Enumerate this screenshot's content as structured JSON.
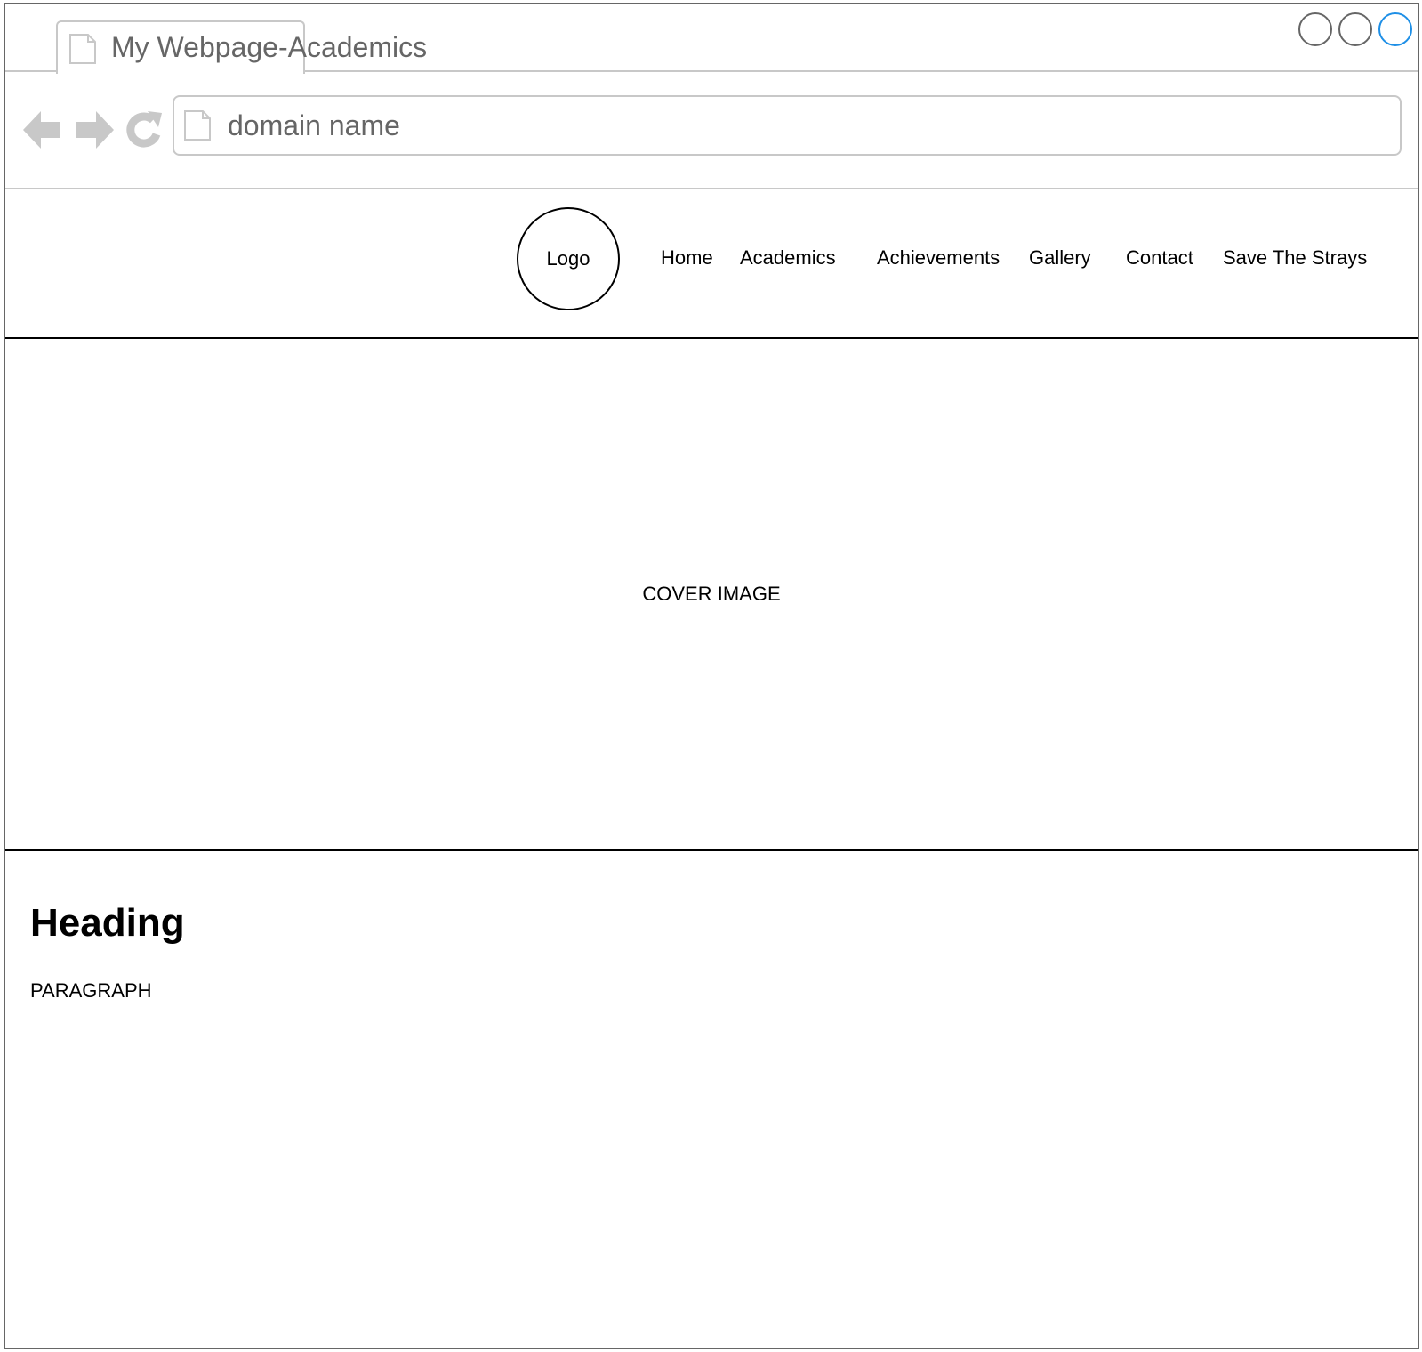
{
  "browser": {
    "tab_title": "My Webpage-Academics",
    "address": "domain name",
    "icons": {
      "tab": "page-icon",
      "back": "arrow-left-icon",
      "forward": "arrow-right-icon",
      "reload": "reload-icon",
      "address": "page-icon"
    },
    "colors": {
      "chrome": "#c8c8c8",
      "active_control": "#1e8fe6"
    }
  },
  "site": {
    "logo": "Logo",
    "nav": [
      "Home",
      "Academics",
      "Achievements",
      "Gallery",
      "Contact",
      "Save The Strays"
    ]
  },
  "cover": {
    "label": "COVER IMAGE"
  },
  "content": {
    "heading": "Heading",
    "paragraph": "PARAGRAPH"
  }
}
